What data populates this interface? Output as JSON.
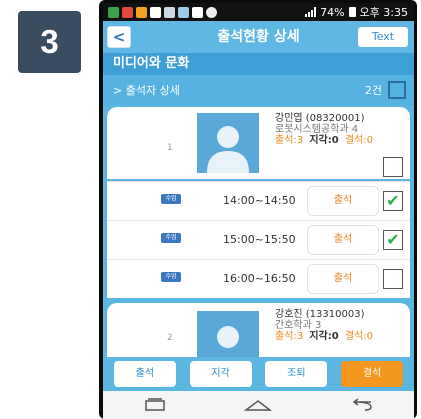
{
  "step": {
    "number": "3"
  },
  "status_bar": {
    "battery": "74%",
    "time": "오후 3:35"
  },
  "header": {
    "title": "출석현황 상세",
    "right_button": "Text",
    "back": "<"
  },
  "section": {
    "title": "미디어와 문화"
  },
  "detail": {
    "label": "> 출석자 상세",
    "count": "2건"
  },
  "students": [
    {
      "index": "1",
      "name": "강민엽 (08320001)",
      "dept": "로봇시스템공학과 4",
      "present": "출석:3",
      "late": "지각:0",
      "absent": "결석:0"
    },
    {
      "index": "2",
      "name": "강호진 (13310003)",
      "dept": "간호학과 3",
      "present": "출석:3",
      "late": "지각:0",
      "absent": "결석:0"
    }
  ],
  "sessions": [
    {
      "tag": "수업",
      "time": "14:00~14:50",
      "status": "출석",
      "checked": true
    },
    {
      "tag": "수업",
      "time": "15:00~15:50",
      "status": "출석",
      "checked": true
    },
    {
      "tag": "수업",
      "time": "16:00~16:50",
      "status": "출석",
      "checked": false
    }
  ],
  "actions": {
    "present": "출석",
    "late": "지각",
    "leave": "조퇴",
    "absent": "결석"
  },
  "colors": {
    "header": "#5fb8e3",
    "accent": "#f5961e",
    "check": "#2bb14a"
  }
}
